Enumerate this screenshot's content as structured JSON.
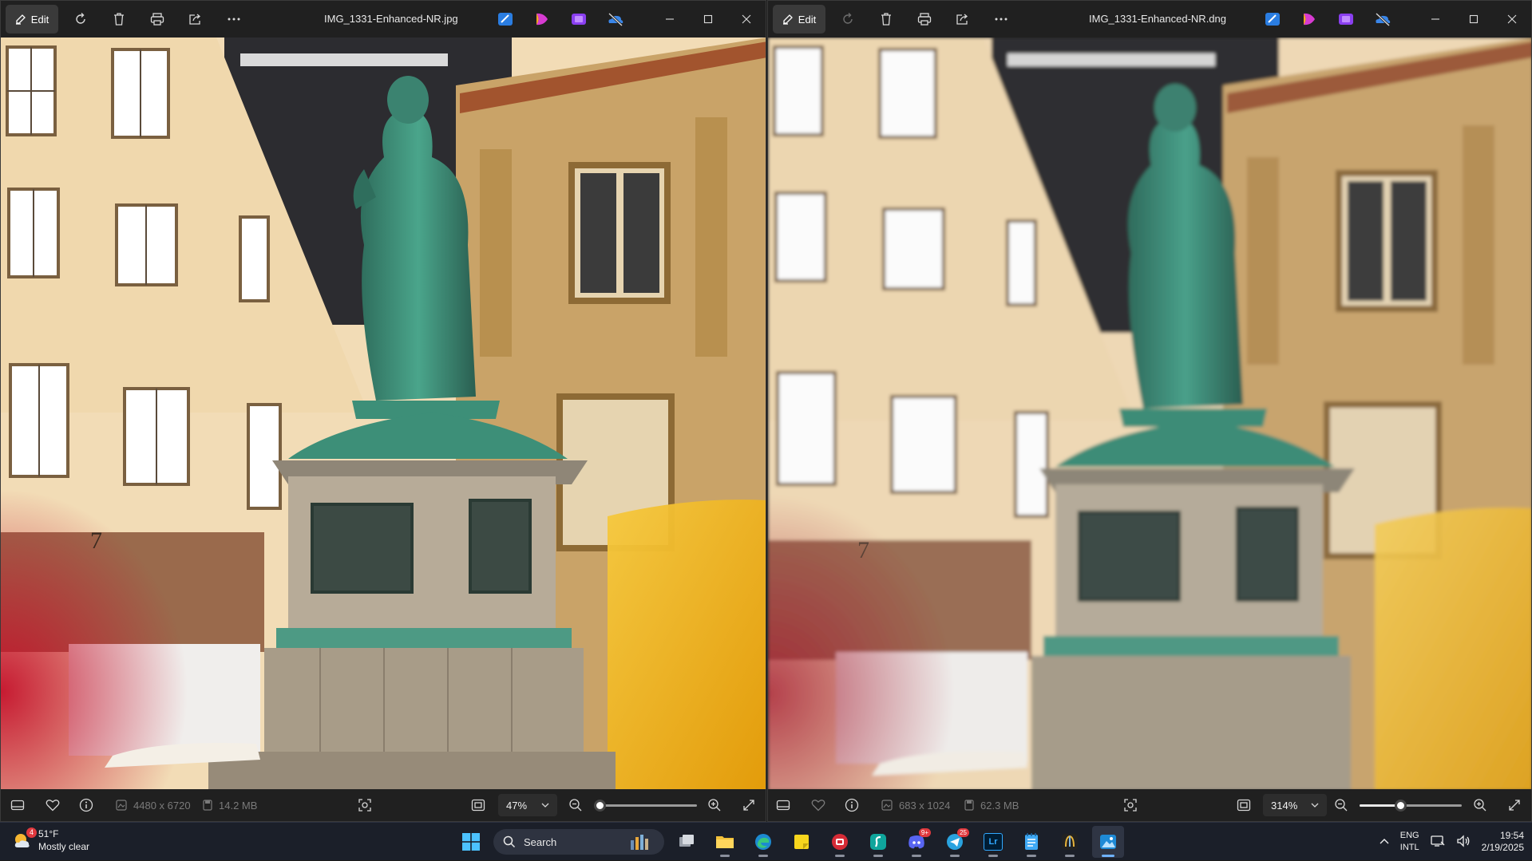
{
  "left_window": {
    "edit_label": "Edit",
    "filename": "IMG_1331-Enhanced-NR.jpg",
    "dimensions": "4480 x 6720",
    "file_size": "14.2 MB",
    "zoom_value": "47%",
    "zoom_fraction": 0.05
  },
  "right_window": {
    "edit_label": "Edit",
    "filename": "IMG_1331-Enhanced-NR.dng",
    "dimensions": "683 x 1024",
    "file_size": "62.3 MB",
    "zoom_value": "314%",
    "zoom_fraction": 0.4
  },
  "photo": {
    "house_number": "7",
    "colors": {
      "left_sky": "#8a8a8a",
      "cream_wall": "#f2dcb6",
      "sandstone": "#c9a368",
      "bronze": "#3d8f78",
      "pedestal": "#b7ab98",
      "red_glow": "#c4102a",
      "yellow_glow": "#f2b90b"
    }
  },
  "taskbar": {
    "weather_badge": "4",
    "weather_temp": "51°F",
    "weather_desc": "Mostly clear",
    "search_label": "Search",
    "discord_badge": "9+",
    "telegram_badge": "25",
    "lr_label": "Lr",
    "lang_primary": "ENG",
    "lang_secondary": "INTL",
    "time": "19:54",
    "date": "2/19/2025"
  },
  "icons": [
    "edit-icon",
    "rotate-icon",
    "delete-icon",
    "print-icon",
    "share-icon",
    "more-icon",
    "fit-icon",
    "zoom-in-icon",
    "zoom-out-icon",
    "fullscreen-icon",
    "heart-icon",
    "info-icon",
    "filmstrip-icon",
    "visual-search-icon"
  ]
}
